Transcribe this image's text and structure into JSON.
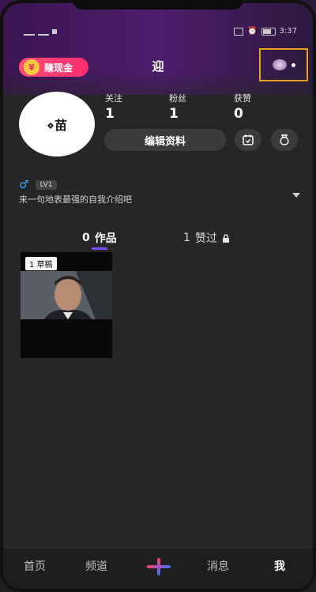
{
  "status": {
    "time": "3:37"
  },
  "header": {
    "earn_label": "赚现金",
    "earn_icon_glyph": "¥",
    "username": "迎"
  },
  "profile": {
    "avatar_text": "⋄苗",
    "stats": [
      {
        "label": "关注",
        "value": "1"
      },
      {
        "label": "粉丝",
        "value": "1"
      },
      {
        "label": "获赞",
        "value": "0"
      }
    ],
    "edit_label": "编辑资料",
    "gender_symbol": "♂",
    "level": "LV1",
    "bio": "来一句地表最强的自我介绍吧"
  },
  "tabs": [
    {
      "count": "0",
      "label": "作品"
    },
    {
      "count": "1",
      "label": "赞过"
    }
  ],
  "works": [
    {
      "badge": "1 草稿"
    }
  ],
  "bottom_nav": [
    {
      "label": "首页"
    },
    {
      "label": "频道"
    },
    {
      "label": "消息"
    },
    {
      "label": "我"
    }
  ],
  "colors": {
    "accent_purple": "#7a4dff",
    "earn_pink": "#ff2d6e",
    "highlight_orange": "#e6a21f"
  }
}
